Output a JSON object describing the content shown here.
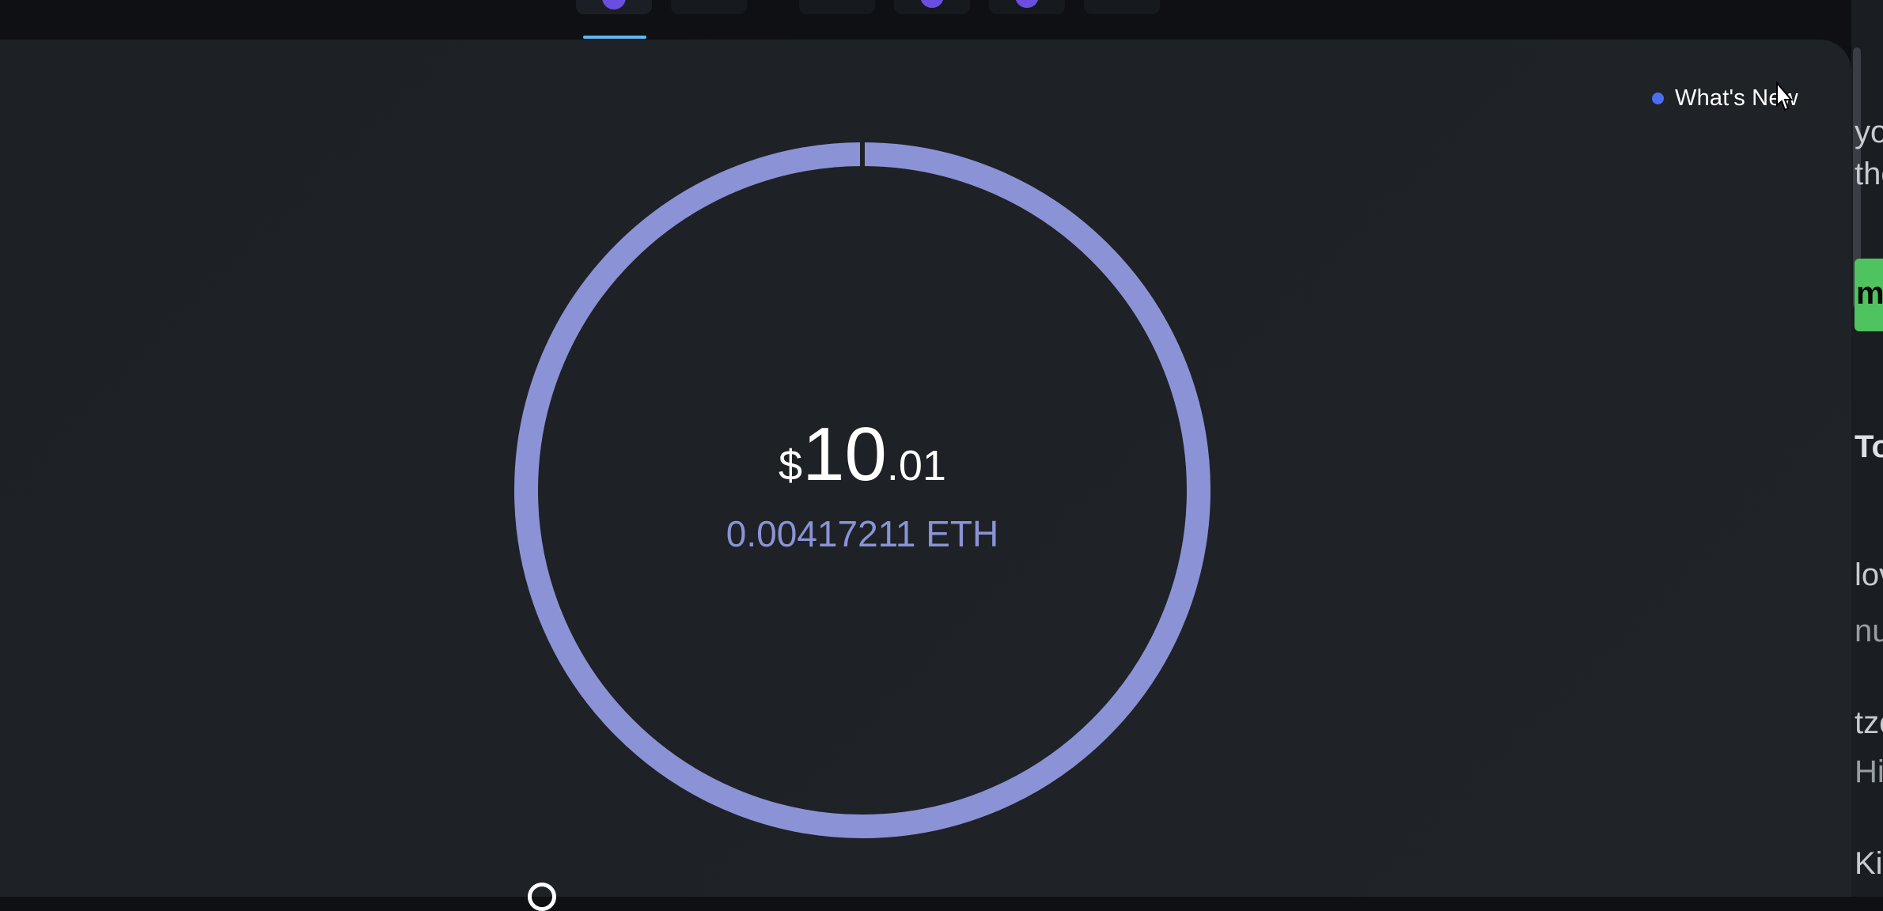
{
  "header": {
    "tabs": [
      {
        "name": "tab-1",
        "active": true
      },
      {
        "name": "tab-2",
        "active": false
      },
      {
        "name": "tab-3",
        "active": false
      },
      {
        "name": "tab-4",
        "active": false
      },
      {
        "name": "tab-5",
        "active": false
      },
      {
        "name": "tab-6",
        "active": false
      }
    ]
  },
  "whats_new": {
    "label": "What's New",
    "dot_color": "#4a6ff0"
  },
  "balance": {
    "currency_symbol": "$",
    "integer": "10",
    "decimal": ".01",
    "crypto": "0.00417211 ETH",
    "ring_color": "#8b93d6"
  },
  "right_strip": {
    "fragments": [
      "yo",
      "the",
      "m",
      "To",
      "lov",
      "nu",
      "tze",
      "Hi",
      "Ki"
    ]
  },
  "colors": {
    "accent": "#5fb7f0",
    "background": "#1e2226",
    "eth_text": "#8b93d6"
  }
}
